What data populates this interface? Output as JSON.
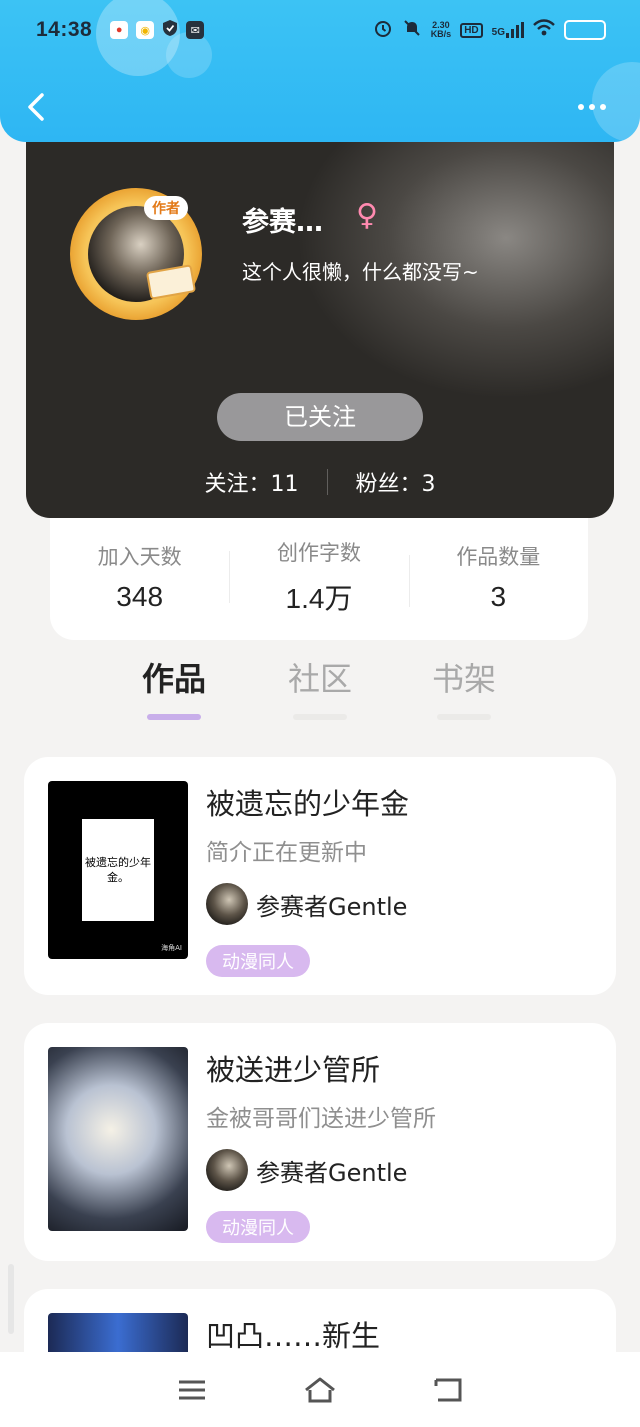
{
  "status_bar": {
    "time": "14:38",
    "net_speed_value": "2.30",
    "net_speed_unit": "KB/s",
    "hd_label": "HD",
    "signal_label": "5G"
  },
  "profile": {
    "author_tag": "作者",
    "name": "参赛…",
    "gender_symbol": "♀",
    "bio": "这个人很懒，什么都没写~",
    "follow_button": "已关注",
    "following_label": "关注：11",
    "followers_label": "粉丝：3"
  },
  "stats": [
    {
      "label": "加入天数",
      "value": "348"
    },
    {
      "label": "创作字数",
      "value": "1.4万"
    },
    {
      "label": "作品数量",
      "value": "3"
    }
  ],
  "tabs": [
    {
      "label": "作品"
    },
    {
      "label": "社区"
    },
    {
      "label": "书架"
    }
  ],
  "works": [
    {
      "title": "被遗忘的少年金",
      "description": "简介正在更新中",
      "author": "参赛者Gentle",
      "tag": "动漫同人",
      "cover_text": "被遗忘的少年金。",
      "cover_mark": "海角AI"
    },
    {
      "title": "被送进少管所",
      "description": "金被哥哥们送进少管所",
      "author": "参赛者Gentle",
      "tag": "动漫同人"
    },
    {
      "title": "凹凸……新生"
    }
  ],
  "colors": {
    "header_blue": "#2eb6f3",
    "tab_active_underline": "#c8aeea",
    "tag_purple": "#d8b9ef",
    "gender_pink": "#ff8ab0"
  },
  "icons": [
    "back-arrow-icon",
    "more-dots-icon",
    "menu-icon",
    "home-icon",
    "return-icon"
  ]
}
